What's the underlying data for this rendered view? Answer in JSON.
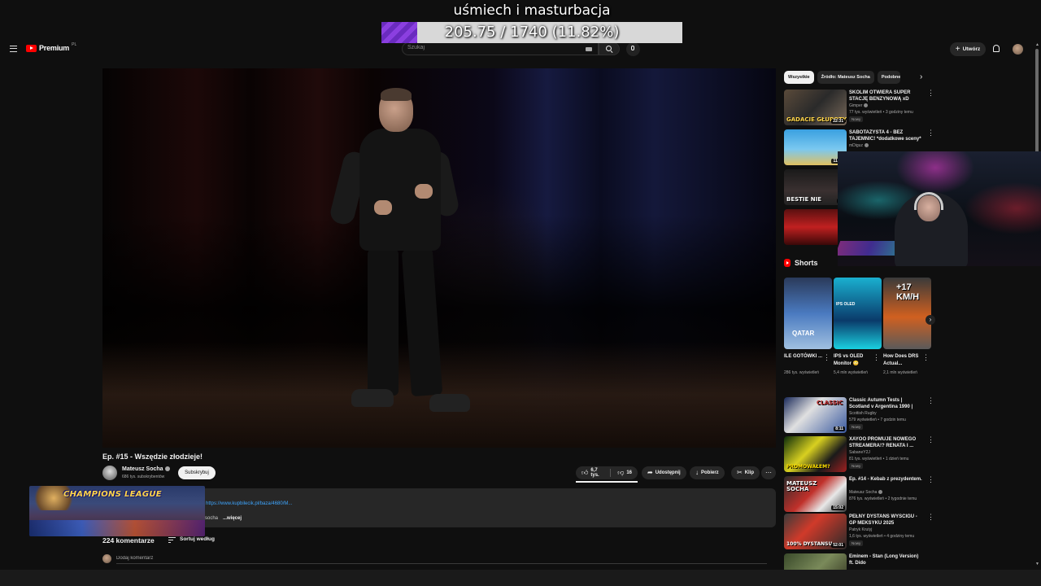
{
  "overlay": {
    "title": "uśmiech i masturbacja",
    "progress_text": "205.75 / 1740 (11.82%)",
    "progress_fraction": 0.1182,
    "champions_league_text": "CHAMPIONS LEAGUE"
  },
  "masthead": {
    "logo_text": "Premium",
    "logo_region": "PL",
    "search_placeholder": "Szukaj",
    "create_label": "Utwórz"
  },
  "video": {
    "title": "Ep. #15 - Wszędzie złodzieje!",
    "channel": "Mateusz Socha",
    "subscribers": "686 tys. subskrybentów",
    "subscribe_label": "Subskrybuj",
    "likes": "6,7 tys.",
    "dislikes": "16",
    "share_label": "Udostępnij",
    "download_label": "Pobierz",
    "clip_label": "Klip",
    "description_link": "https://www.kupbilecik.pl/baza/4680/M...",
    "description_prefix": "socha",
    "more_label": "...więcej"
  },
  "comments": {
    "count_label": "224 komentarze",
    "sort_label": "Sortuj według",
    "add_placeholder": "Dodaj komentarz"
  },
  "sidebar": {
    "chips": [
      "Wszystkie",
      "Źródło: Mateusz Socha",
      "Podobne"
    ],
    "recommendations_top": [
      {
        "title": "SKOLIM OTWIERA SUPER STACJĘ BENZYNOWĄ xD",
        "channel": "Gimper",
        "meta": "77 tys. wyświetleń • 3 godziny temu",
        "badge": "Nowy",
        "duration": "22:31",
        "caption": "GADACIE GŁUPOTY"
      },
      {
        "title": "SABOTAŻYSTA 4 - BEZ TAJEMNIC! *dodatkowe sceny*",
        "channel": "mDiguz",
        "meta": "",
        "badge": "",
        "duration": "11:57",
        "caption": ""
      },
      {
        "title": "",
        "channel": "",
        "meta": "",
        "badge": "",
        "duration": "27",
        "caption": "BESTIE NIE"
      },
      {
        "title": "",
        "channel": "",
        "meta": "",
        "badge": "",
        "duration": "4",
        "caption": ""
      }
    ],
    "shorts_heading": "Shorts",
    "shorts": [
      {
        "title": "ILE GOTÓWKI ...",
        "views": "286 tys. wyświetleń",
        "overlay": "QATAR"
      },
      {
        "title": "IPS vs OLED Monitor 😳",
        "views": "5,4 mln wyświetleń",
        "overlay": "IPS OLED"
      },
      {
        "title": "How Does DRS Actual...",
        "views": "2,1 mln wyświetleń",
        "overlay": "+17 KM/H"
      }
    ],
    "recommendations_bottom": [
      {
        "title": "Classic Autumn Tests | Scotland v Argentina 1990 | Highlights",
        "channel": "Scottish Rugby",
        "meta": "579 wyświetleń • 7 godzin temu",
        "badge": "Nowy",
        "duration": "8:11",
        "caption": "CLASSIC"
      },
      {
        "title": "XAYOO PROMUJE NOWEGO STREAMERA!? RENATA I ...",
        "channel": "SabaneY2J",
        "meta": "81 tys. wyświetleń • 1 dzień temu",
        "badge": "Nowy",
        "duration": "",
        "caption": "PROMOWAŁEM?"
      },
      {
        "title": "Ep. #14 - Kebab z prezydentem.",
        "channel": "Mateusz Socha",
        "meta": "876 tys. wyświetleń • 2 tygodnie temu",
        "badge": "",
        "duration": "15:02",
        "caption": "MATEUSZ SOCHA"
      },
      {
        "title": "PEŁNY DYSTANS WYŚCIGU - GP MEKSYKU 2025",
        "channel": "Patryk Krutyj",
        "meta": "1,6 tys. wyświetleń • 4 godziny temu",
        "badge": "Nowy",
        "duration": "52:01",
        "caption": "100% DYSTANSU"
      },
      {
        "title": "Eminem - Stan (Long Version) ft. Dido",
        "channel": "",
        "meta": "",
        "badge": "",
        "duration": "",
        "caption": ""
      }
    ]
  },
  "colors": {
    "background": "#0f0f0f",
    "accent_red": "#ff0000",
    "link_blue": "#3ea6ff",
    "overlay_purple": "#8b3fe0"
  }
}
